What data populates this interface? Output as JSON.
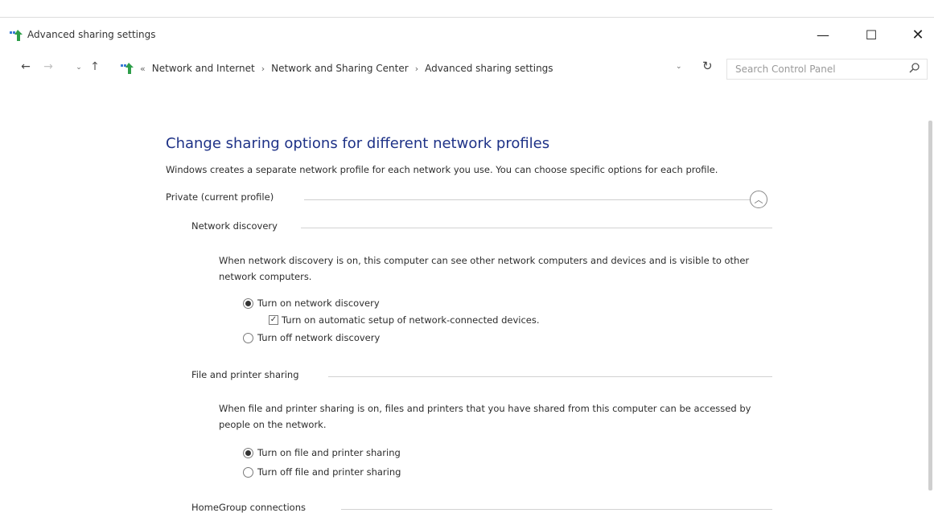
{
  "window": {
    "title": "Advanced sharing settings",
    "minimize_glyph": "—",
    "maximize_glyph": "☐",
    "close_glyph": "✕"
  },
  "nav": {
    "back_glyph": "←",
    "forward_glyph": "→",
    "recent_glyph": "⌄",
    "up_glyph": "↑",
    "breadcrumb": [
      "Network and Internet",
      "Network and Sharing Center",
      "Advanced sharing settings"
    ],
    "breadcrumb_lead_sep": "«",
    "breadcrumb_sep": "›",
    "dropdown_glyph": "⌄",
    "refresh_glyph": "↻",
    "search_placeholder": "Search Control Panel"
  },
  "icons": {
    "app": "network-sharing-icon",
    "search": "search-icon"
  },
  "colors": {
    "heading": "#1e3287",
    "body_text": "#2d2d2d"
  },
  "main": {
    "heading": "Change sharing options for different network profiles",
    "intro": "Windows creates a separate network profile for each network you use. You can choose specific options for each profile.",
    "profile_label": "Private (current profile)",
    "collapse_glyph": "︿",
    "network_discovery": {
      "label": "Network discovery",
      "description": "When network discovery is on, this computer can see other network computers and devices and is visible to other network computers.",
      "option_on": "Turn on network discovery",
      "option_on_selected": true,
      "auto_setup": "Turn on automatic setup of network-connected devices.",
      "auto_setup_checked": true,
      "option_off": "Turn off network discovery",
      "check_glyph": "✓"
    },
    "file_sharing": {
      "label": "File and printer sharing",
      "description": "When file and printer sharing is on, files and printers that you have shared from this computer can be accessed by people on the network.",
      "option_on": "Turn on file and printer sharing",
      "option_on_selected": true,
      "option_off": "Turn off file and printer sharing"
    },
    "homegroup": {
      "label": "HomeGroup connections"
    }
  }
}
